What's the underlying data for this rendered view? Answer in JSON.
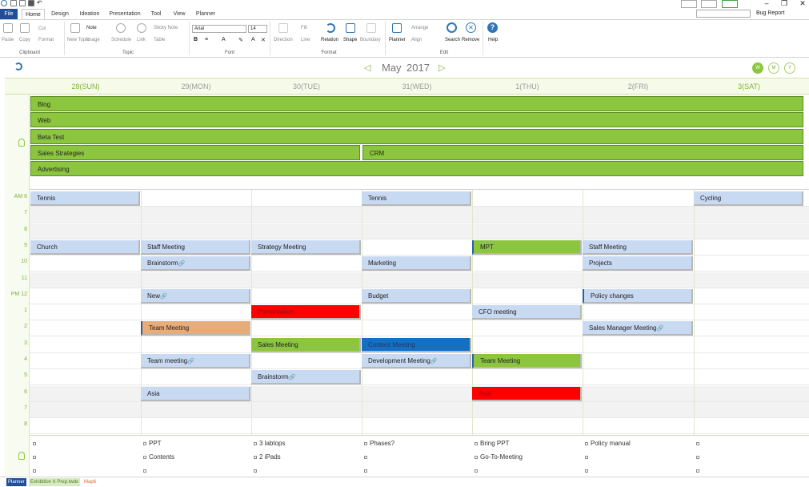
{
  "window": {
    "bug_report": "Bug Report"
  },
  "ribbon_tabs": [
    "File",
    "Home",
    "Design",
    "Ideation",
    "Presentation",
    "Tool",
    "View",
    "Planner"
  ],
  "ribbon": {
    "cut": "Cut",
    "copy": "Copy",
    "paste": "Paste",
    "format": "Format",
    "new_topic": "New Topic",
    "note": "Note",
    "image": "Image",
    "schedule": "Schedule",
    "link": "Link",
    "sticky_note": "Sticky Note",
    "table": "Table",
    "font_name": "Arial",
    "font_size": "14",
    "direction": "Direction",
    "fill": "Fill",
    "line": "Line",
    "relation": "Relation",
    "shape": "Shape",
    "boundary": "Boundary",
    "planner": "Planner",
    "arrange": "Arrange",
    "align": "Align",
    "search": "Search",
    "remove": "Remove",
    "help": "Help",
    "groups": {
      "clipboard": "Clipboard",
      "topic": "Topic",
      "font": "Font",
      "format": "Format",
      "edit": "Edit"
    }
  },
  "planner": {
    "month": "May",
    "year": "2017",
    "views": [
      "W",
      "M",
      "Y"
    ],
    "days": [
      "28(SUN)",
      "29(MON)",
      "30(TUE)",
      "31(WED)",
      "1(THU)",
      "2(FRI)",
      "3(SAT)"
    ],
    "hours": [
      "AM 6",
      "7",
      "8",
      "9",
      "10",
      "11",
      "PM 12",
      "1",
      "2",
      "3",
      "4",
      "5",
      "6",
      "7",
      "8"
    ],
    "allday_events": [
      {
        "label": "Blog"
      },
      {
        "label": "Web"
      },
      {
        "label": "Beta Test"
      },
      {
        "label": "Sales Strategies"
      },
      {
        "label": "CRM"
      },
      {
        "label": "Advertising"
      }
    ],
    "events": [
      {
        "label": "Tennis",
        "day": 0,
        "hour": 0,
        "color": "blue"
      },
      {
        "label": "Tennis",
        "day": 3,
        "hour": 0,
        "color": "blue"
      },
      {
        "label": "Cycling",
        "day": 6,
        "hour": 0,
        "color": "blue"
      },
      {
        "label": "Church",
        "day": 0,
        "hour": 3,
        "color": "blue"
      },
      {
        "label": "Staff Meeting",
        "day": 1,
        "hour": 3,
        "color": "blue"
      },
      {
        "label": "Strategy Meeting",
        "day": 2,
        "hour": 3,
        "color": "blue"
      },
      {
        "label": "MPT",
        "day": 4,
        "hour": 3,
        "color": "green",
        "accent": true
      },
      {
        "label": "Staff Meeting",
        "day": 5,
        "hour": 3,
        "color": "blue"
      },
      {
        "label": "Brainstorm",
        "day": 1,
        "hour": 4,
        "color": "blue",
        "linked": true
      },
      {
        "label": "Marketing",
        "day": 3,
        "hour": 4,
        "color": "blue"
      },
      {
        "label": "Projects",
        "day": 5,
        "hour": 4,
        "color": "blue"
      },
      {
        "label": "New",
        "day": 1,
        "hour": 6,
        "color": "blue",
        "linked": true
      },
      {
        "label": "Budget",
        "day": 3,
        "hour": 6,
        "color": "blue"
      },
      {
        "label": "Policy changes",
        "day": 5,
        "hour": 6,
        "color": "blue",
        "accent": true
      },
      {
        "label": "Presentation",
        "day": 2,
        "hour": 7,
        "color": "red"
      },
      {
        "label": "CFO meeting",
        "day": 4,
        "hour": 7,
        "color": "blue"
      },
      {
        "label": "Team Meeting",
        "day": 1,
        "hour": 8,
        "color": "orange",
        "accent": true
      },
      {
        "label": "Sales Manager Meeting",
        "day": 5,
        "hour": 8,
        "color": "blue",
        "linked": true
      },
      {
        "label": "Sales Meeting",
        "day": 2,
        "hour": 9,
        "color": "green"
      },
      {
        "label": "Content Meeting",
        "day": 3,
        "hour": 9,
        "color": "navy"
      },
      {
        "label": "Team meeting",
        "day": 1,
        "hour": 10,
        "color": "blue",
        "linked": true
      },
      {
        "label": "Development Meeting",
        "day": 3,
        "hour": 10,
        "color": "blue",
        "linked": true
      },
      {
        "label": "Team Meeting",
        "day": 4,
        "hour": 10,
        "color": "green",
        "accent": true
      },
      {
        "label": "Brainstorm",
        "day": 2,
        "hour": 11,
        "color": "blue",
        "linked": true
      },
      {
        "label": "Asia",
        "day": 1,
        "hour": 12,
        "color": "blue"
      },
      {
        "label": "Asia",
        "day": 4,
        "hour": 12,
        "color": "red"
      }
    ],
    "notes": [
      {
        "label": "PPT",
        "day": 1,
        "row": 0
      },
      {
        "label": "3 labtops",
        "day": 2,
        "row": 0
      },
      {
        "label": "Phases?",
        "day": 3,
        "row": 0
      },
      {
        "label": "Bring PPT",
        "day": 4,
        "row": 0
      },
      {
        "label": "Policy manual",
        "day": 5,
        "row": 0
      },
      {
        "label": "Contents",
        "day": 1,
        "row": 1
      },
      {
        "label": "2 iPads",
        "day": 2,
        "row": 1
      },
      {
        "label": "Go-To-Meeting",
        "day": 4,
        "row": 1
      }
    ]
  },
  "status_tabs": [
    "Planner",
    "Exhibition X Prep.twdx",
    "Map6"
  ],
  "colors": {
    "accent_green": "#8cc63f",
    "event_blue": "#c8d9f2",
    "file_tab": "#1f4e9b"
  },
  "icons": [
    "refresh-icon",
    "idea-bulb-icon",
    "link-icon",
    "search-icon",
    "remove-icon",
    "help-icon"
  ]
}
